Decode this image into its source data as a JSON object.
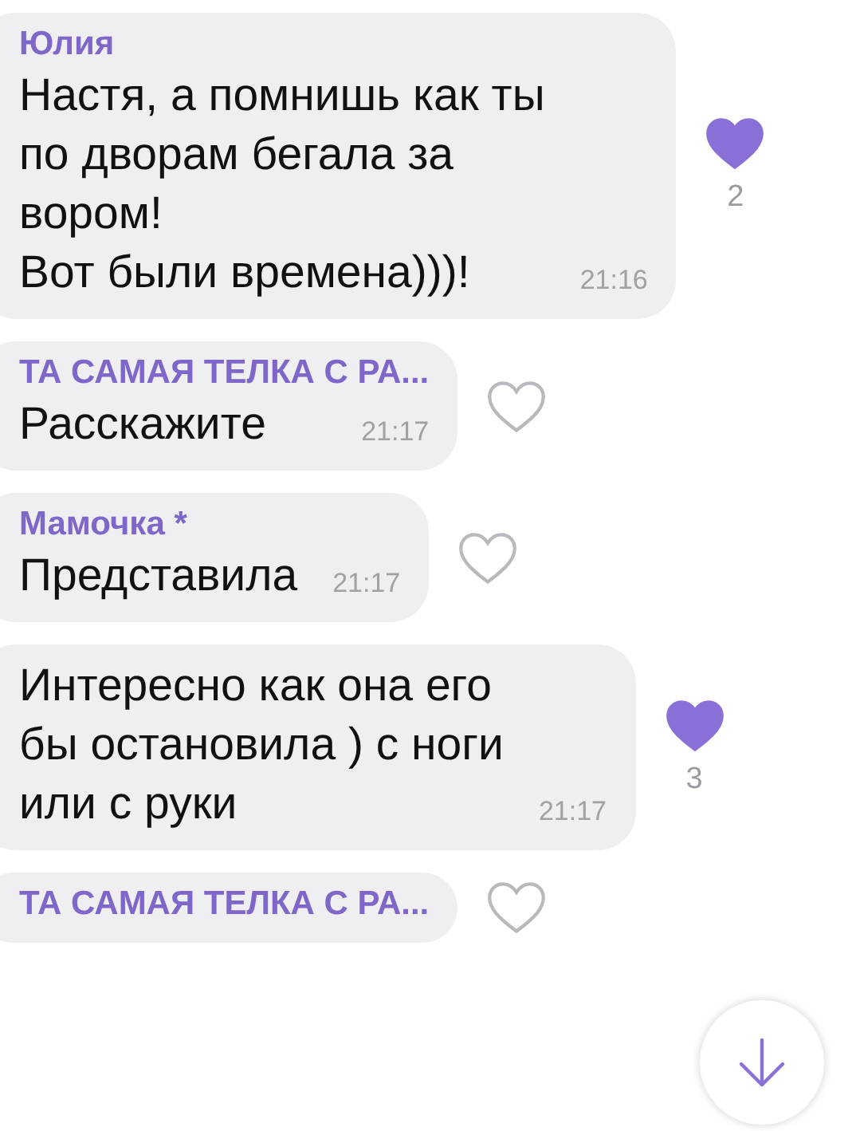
{
  "messages": [
    {
      "sender": "Юлия",
      "text": "Настя, а помнишь как ты\nпо дворам бегала за\nвором!\nВот были времена)))!",
      "time": "21:16",
      "reaction": {
        "liked": true,
        "count": "2"
      }
    },
    {
      "sender": "ТА САМАЯ ТЕЛКА С РА...",
      "text": "Расскажите",
      "time": "21:17",
      "reaction": {
        "liked": false
      }
    },
    {
      "sender": "Мамочка *",
      "text": "Представила",
      "time": "21:17",
      "reaction": {
        "liked": false
      }
    },
    {
      "text": "Интересно как она его\nбы остановила ) с ноги\nили с руки",
      "time": "21:17",
      "reaction": {
        "liked": true,
        "count": "3"
      }
    },
    {
      "sender": "ТА САМАЯ ТЕЛКА С РА...",
      "reaction": {
        "liked": false
      }
    }
  ]
}
